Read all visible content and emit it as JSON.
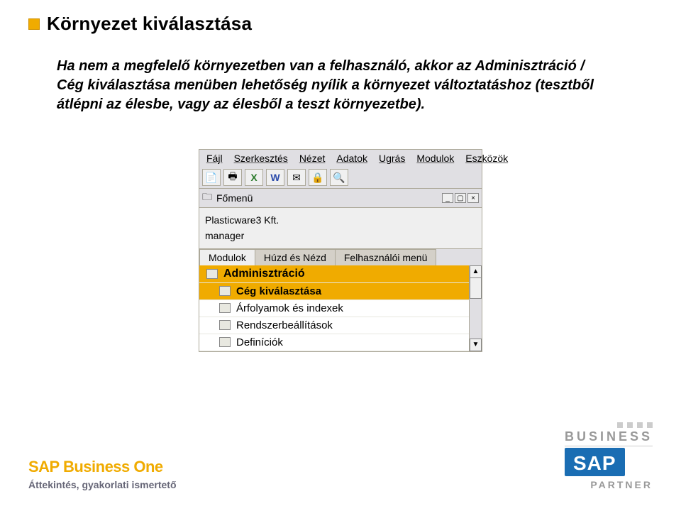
{
  "header": {
    "title": "Környezet kiválasztása"
  },
  "body": {
    "paragraph": "Ha nem a megfelelő környezetben van a felhasználó, akkor az Adminisztráció / Cég kiválasztása menüben lehetőség nyílik a környezet változtatáshoz (tesztből átlépni az élesbe, vagy az élesből a teszt környezetbe)."
  },
  "app": {
    "menubar": [
      "Fájl",
      "Szerkesztés",
      "Nézet",
      "Adatok",
      "Ugrás",
      "Modulok",
      "Eszközök"
    ],
    "panel_title": "Főmenü",
    "company": "Plasticware3 Kft.",
    "role": "manager",
    "tabs": [
      "Modulok",
      "Húzd és Nézd",
      "Felhasználói menü"
    ],
    "active_tab_index": 0,
    "list_header": "Adminisztráció",
    "list_selected": "Cég kiválasztása",
    "list_items": [
      "Árfolyamok és indexek",
      "Rendszerbeállítások",
      "Definíciók"
    ]
  },
  "footer": {
    "product": "SAP Business One",
    "subtitle": "Áttekintés, gyakorlati ismertető",
    "brand_top": "BUSINESS",
    "brand_logo": "SAP",
    "brand_bottom": "PARTNER"
  }
}
